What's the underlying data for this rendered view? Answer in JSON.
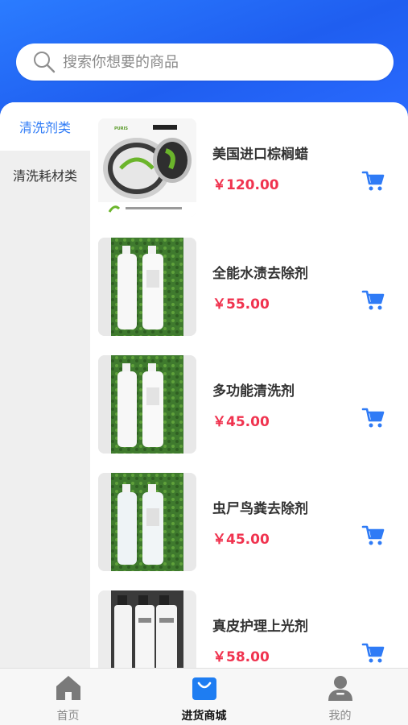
{
  "search": {
    "placeholder": "搜索你想要的商品"
  },
  "sidebar": {
    "items": [
      {
        "label": "清洗剂类",
        "active": true
      },
      {
        "label": "清洗耗材类",
        "active": false
      }
    ]
  },
  "products": [
    {
      "name": "美国进口棕榈蜡",
      "price": "￥120.00",
      "image": "wax-tin-image"
    },
    {
      "name": "全能水渍去除剂",
      "price": "￥55.00",
      "image": "bottles-image"
    },
    {
      "name": "多功能清洗剂",
      "price": "￥45.00",
      "image": "bottles-image"
    },
    {
      "name": "虫尸鸟粪去除剂",
      "price": "￥45.00",
      "image": "bottles-image"
    },
    {
      "name": "真皮护理上光剂",
      "price": "￥58.00",
      "image": "bottles-image"
    }
  ],
  "tabbar": {
    "items": [
      {
        "label": "首页",
        "icon": "home-icon"
      },
      {
        "label": "进货商城",
        "icon": "shopping-bag-icon",
        "active": true
      },
      {
        "label": "我的",
        "icon": "user-icon"
      }
    ]
  },
  "colors": {
    "accent": "#2f7bf6",
    "price": "#f0334f",
    "header": "#2b7cff"
  }
}
